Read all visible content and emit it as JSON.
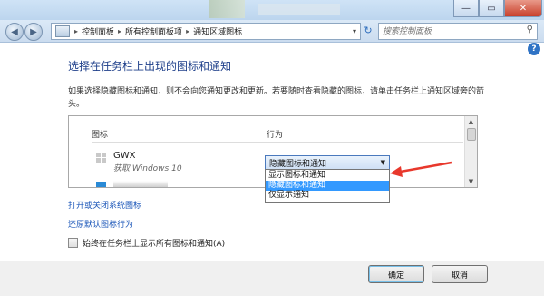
{
  "window": {
    "minimize_glyph": "—",
    "maximize_glyph": "▭",
    "close_glyph": "✕"
  },
  "nav": {
    "back_glyph": "◀",
    "forward_glyph": "▶",
    "breadcrumb": [
      "控制面板",
      "所有控制面板项",
      "通知区域图标"
    ],
    "separator": "▸",
    "refresh_glyph": "↻",
    "search_placeholder": "搜索控制面板"
  },
  "help_glyph": "?",
  "page": {
    "heading": "选择在任务栏上出现的图标和通知",
    "description": "如果选择隐藏图标和通知，则不会向您通知更改和更新。若要随时查看隐藏的图标，请单击任务栏上通知区域旁的箭头。"
  },
  "list": {
    "col_icon": "图标",
    "col_behavior": "行为",
    "items": [
      {
        "name": "GWX",
        "subtitle": "获取 Windows 10",
        "behavior": "隐藏图标和通知"
      }
    ]
  },
  "dropdown": {
    "selected": "隐藏图标和通知",
    "options": [
      "显示图标和通知",
      "隐藏图标和通知",
      "仅显示通知"
    ],
    "highlighted_index": 1
  },
  "links": {
    "system_icons": "打开或关闭系统图标",
    "restore_default": "还原默认图标行为"
  },
  "checkbox": {
    "label": "始终在任务栏上显示所有图标和通知(A)",
    "checked": false
  },
  "buttons": {
    "ok": "确定",
    "cancel": "取消"
  },
  "colors": {
    "heading": "#1e3f8a",
    "link": "#1c57b9",
    "selection": "#3399ff",
    "annotation_arrow": "#e8382c"
  }
}
